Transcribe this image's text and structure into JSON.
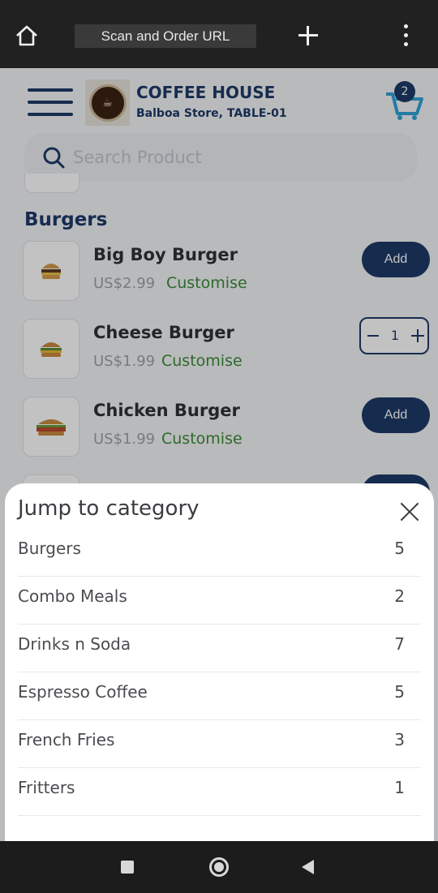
{
  "browser": {
    "url": "Scan and Order URL",
    "home_icon": "home-icon",
    "new_tab_icon": "plus-icon",
    "menu_icon": "kebab-menu-icon"
  },
  "header": {
    "store_name": "COFFEE HOUSE",
    "store_sub": "Balboa Store, TABLE-01",
    "logo_text": "COFFEE HOUSE",
    "cart_count": "2"
  },
  "search": {
    "placeholder": "Search Product"
  },
  "section": {
    "title": "Burgers"
  },
  "products": [
    {
      "name": "Big Boy Burger",
      "price": "US$2.99",
      "customise": "Customise",
      "action": "Add"
    },
    {
      "name": "Cheese Burger",
      "price": "US$1.99",
      "customise": "Customise",
      "quantity": "1"
    },
    {
      "name": "Chicken Burger",
      "price": "US$1.99",
      "customise": "Customise",
      "action": "Add"
    }
  ],
  "sheet": {
    "title": "Jump to category",
    "categories": [
      {
        "label": "Burgers",
        "count": "5"
      },
      {
        "label": "Combo Meals",
        "count": "2"
      },
      {
        "label": "Drinks n Soda",
        "count": "7"
      },
      {
        "label": "Espresso Coffee",
        "count": "5"
      },
      {
        "label": "French Fries",
        "count": "3"
      },
      {
        "label": "Fritters",
        "count": "1"
      }
    ]
  },
  "colors": {
    "brand": "#1d3a68",
    "accent_green": "#3a8a3a",
    "cart_icon": "#2ea3d6"
  }
}
